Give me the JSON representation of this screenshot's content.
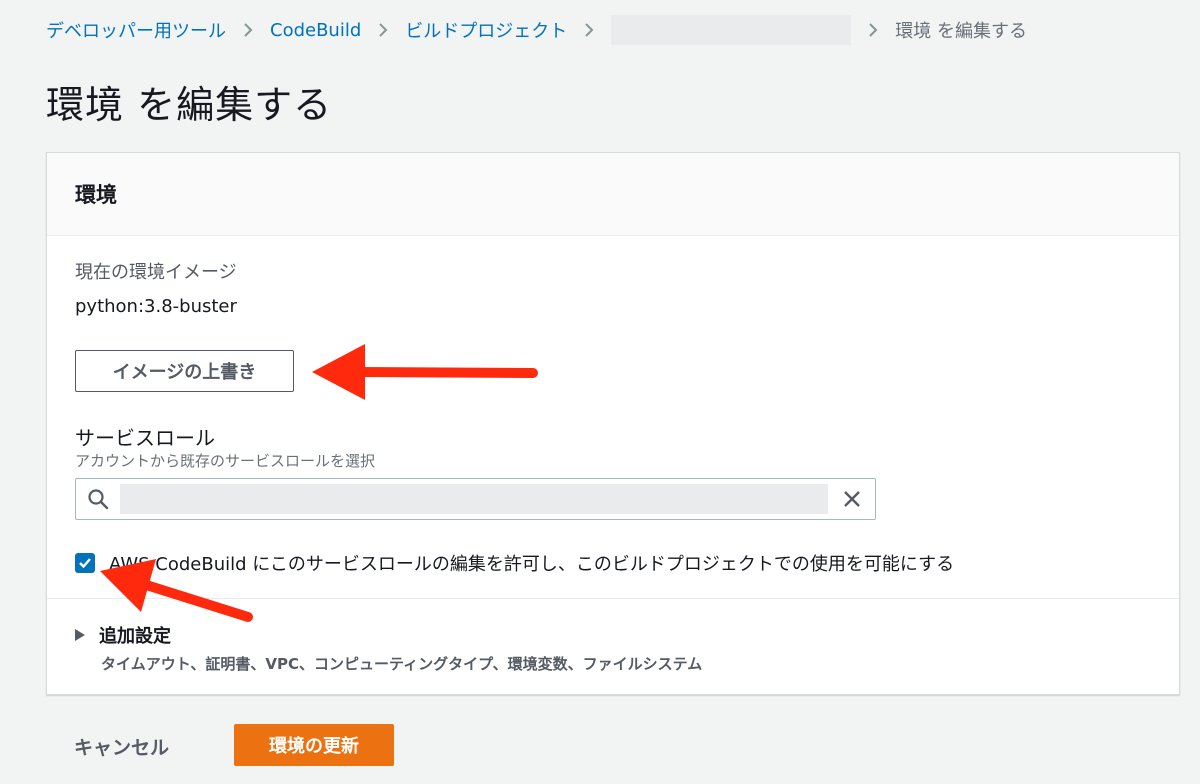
{
  "breadcrumb": {
    "items": [
      "デベロッパー用ツール",
      "CodeBuild",
      "ビルドプロジェクト"
    ],
    "current": "環境 を編集する"
  },
  "page": {
    "title": "環境 を編集する"
  },
  "panel": {
    "title": "環境",
    "current_image_label": "現在の環境イメージ",
    "current_image_value": "python:3.8-buster",
    "override_button": "イメージの上書き",
    "service_role_label": "サービスロール",
    "service_role_desc": "アカウントから既存のサービスロールを選択",
    "allow_edit_checkbox": {
      "checked": true,
      "label": "AWS CodeBuild にこのサービスロールの編集を許可し、このビルドプロジェクトでの使用を可能にする"
    },
    "additional_settings": {
      "label": "追加設定",
      "desc": "タイムアウト、証明書、VPC、コンピューティングタイプ、環境変数、ファイルシステム"
    }
  },
  "actions": {
    "cancel": "キャンセル",
    "submit": "環境の更新"
  },
  "colors": {
    "link": "#0073bb",
    "primary": "#ec7211",
    "annotation": "#ff2a0e"
  }
}
